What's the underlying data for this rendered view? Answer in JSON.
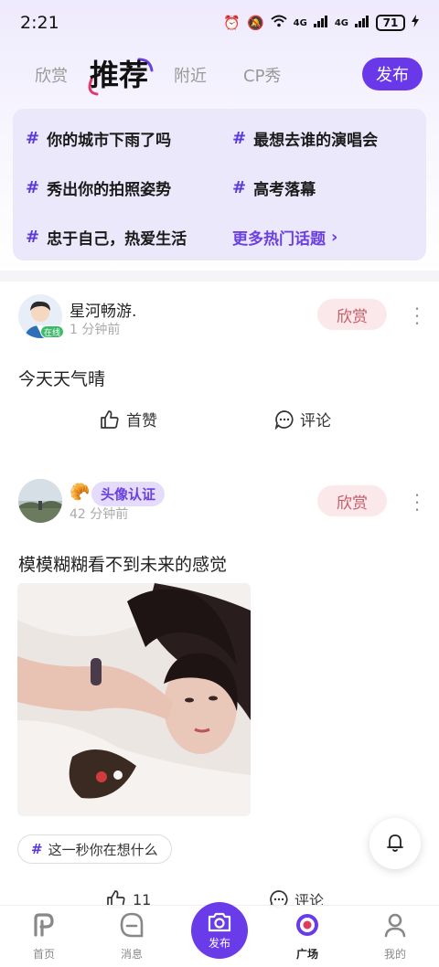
{
  "status_bar": {
    "time": "2:21",
    "signal1": "4G",
    "signal2": "4G",
    "battery": "71"
  },
  "top_nav": {
    "tabs": [
      {
        "label": "欣赏"
      },
      {
        "label": "推荐"
      },
      {
        "label": "附近"
      },
      {
        "label": "CP秀"
      }
    ],
    "active_tab": "推荐",
    "publish_label": "发布"
  },
  "topics": {
    "items": [
      {
        "label": "你的城市下雨了吗"
      },
      {
        "label": "最想去谁的演唱会"
      },
      {
        "label": "秀出你的拍照姿势"
      },
      {
        "label": "高考落幕"
      },
      {
        "label": "忠于自己，热爱生活"
      }
    ],
    "more_label": "更多热门话题"
  },
  "posts": [
    {
      "username": "星河畅游.",
      "time_ago": "1 分钟前",
      "online_label": "在线",
      "appreciate_label": "欣赏",
      "text": "今天天气晴",
      "like_label": "首赞",
      "comment_label": "评论"
    },
    {
      "badge_label": "头像认证",
      "time_ago": "42 分钟前",
      "appreciate_label": "欣赏",
      "text": "模模糊糊看不到未来的感觉",
      "topic_chip": "这一秒你在想什么",
      "like_count": "11",
      "comment_label": "评论"
    }
  ],
  "bottom_nav": {
    "items": [
      {
        "label": "首页"
      },
      {
        "label": "消息"
      },
      {
        "label": "发布"
      },
      {
        "label": "广场"
      },
      {
        "label": "我的"
      }
    ],
    "active": "广场"
  },
  "colors": {
    "accent": "#6938e8",
    "appreciate_bg": "#fbe8ea",
    "appreciate_text": "#c75a67",
    "topics_bg": "#ece8fb"
  }
}
